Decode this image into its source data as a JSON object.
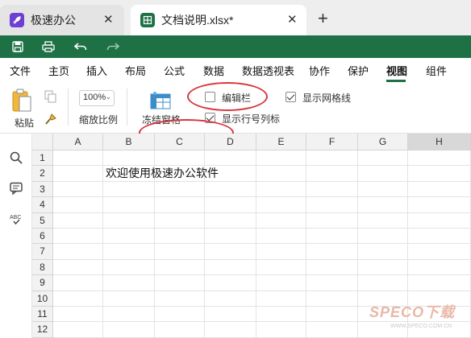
{
  "tabs": [
    {
      "label": "极速办公"
    },
    {
      "label": "文档说明.xlsx*"
    }
  ],
  "new_tab_label": "+",
  "menu": [
    "文件",
    "主页",
    "插入",
    "布局",
    "公式",
    "数据",
    "数据透视表",
    "协作",
    "保护",
    "视图",
    "组件"
  ],
  "active_menu": "视图",
  "ribbon": {
    "paste_label": "粘贴",
    "zoom_value": "100%",
    "zoom_label": "缩放比例",
    "freeze_label": "冻结窗格",
    "formula_bar_label": "编辑栏",
    "formula_bar_checked": false,
    "gridlines_label": "显示网格线",
    "gridlines_checked": true,
    "headings_label": "显示行号列标",
    "headings_checked": true
  },
  "columns": [
    "A",
    "B",
    "C",
    "D",
    "E",
    "F",
    "G",
    "H"
  ],
  "selected_column": "H",
  "rows": [
    "1",
    "2",
    "3",
    "4",
    "5",
    "6",
    "7",
    "8",
    "9",
    "10",
    "11",
    "12"
  ],
  "cell_B2": "欢迎使用极速办公软件",
  "watermark": {
    "main": "SPECO下载",
    "sub": "WWW.SPECO.COM.CN"
  },
  "colors": {
    "accent": "#1e7145",
    "annotation": "#d9363e",
    "app_icon": "#6d3fd2"
  }
}
